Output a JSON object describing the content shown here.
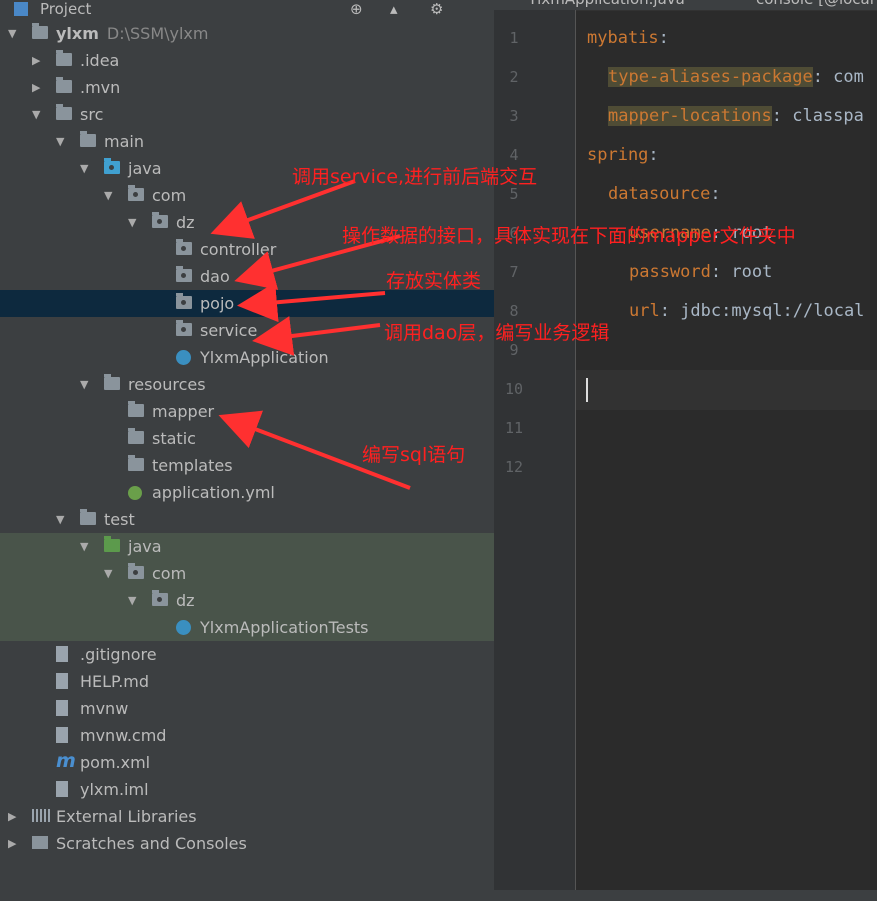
{
  "panel": {
    "title": "Project"
  },
  "tree": [
    {
      "label": "ylxm",
      "path": "D:\\SSM\\ylxm",
      "level": 0,
      "arrow": "down",
      "icon": "module"
    },
    {
      "label": ".idea",
      "level": 1,
      "arrow": "right",
      "icon": "folder"
    },
    {
      "label": ".mvn",
      "level": 1,
      "arrow": "right",
      "icon": "folder"
    },
    {
      "label": "src",
      "level": 1,
      "arrow": "down",
      "icon": "folder"
    },
    {
      "label": "main",
      "level": 2,
      "arrow": "down",
      "icon": "folder"
    },
    {
      "label": "java",
      "level": 3,
      "arrow": "down",
      "icon": "source-folder"
    },
    {
      "label": "com",
      "level": 4,
      "arrow": "down",
      "icon": "package"
    },
    {
      "label": "dz",
      "level": 5,
      "arrow": "down",
      "icon": "package"
    },
    {
      "label": "controller",
      "level": 6,
      "icon": "package"
    },
    {
      "label": "dao",
      "level": 6,
      "icon": "package"
    },
    {
      "label": "pojo",
      "level": 6,
      "icon": "package",
      "selected": true
    },
    {
      "label": "service",
      "level": 6,
      "icon": "package"
    },
    {
      "label": "YlxmApplication",
      "level": 6,
      "icon": "spring-class"
    },
    {
      "label": "resources",
      "level": 3,
      "arrow": "down",
      "icon": "resources-folder"
    },
    {
      "label": "mapper",
      "level": 4,
      "icon": "folder"
    },
    {
      "label": "static",
      "level": 4,
      "icon": "folder"
    },
    {
      "label": "templates",
      "level": 4,
      "icon": "folder"
    },
    {
      "label": "application.yml",
      "level": 4,
      "icon": "yml"
    },
    {
      "label": "test",
      "level": 2,
      "arrow": "down",
      "icon": "folder"
    },
    {
      "label": "java",
      "level": 3,
      "arrow": "down",
      "icon": "test-folder",
      "test": true
    },
    {
      "label": "com",
      "level": 4,
      "arrow": "down",
      "icon": "package",
      "test": true
    },
    {
      "label": "dz",
      "level": 5,
      "arrow": "down",
      "icon": "package",
      "test": true
    },
    {
      "label": "YlxmApplicationTests",
      "level": 6,
      "icon": "class",
      "test": true
    },
    {
      "label": ".gitignore",
      "level": 1,
      "icon": "file"
    },
    {
      "label": "HELP.md",
      "level": 1,
      "icon": "file"
    },
    {
      "label": "mvnw",
      "level": 1,
      "icon": "file"
    },
    {
      "label": "mvnw.cmd",
      "level": 1,
      "icon": "file"
    },
    {
      "label": "pom.xml",
      "level": 1,
      "icon": "maven"
    },
    {
      "label": "ylxm.iml",
      "level": 1,
      "icon": "file"
    },
    {
      "label": "External Libraries",
      "level": 0,
      "arrow": "right",
      "icon": "library"
    },
    {
      "label": "Scratches and Consoles",
      "level": 0,
      "arrow": "right",
      "icon": "scratches"
    }
  ],
  "editor": {
    "tabs": [
      "YlxmApplication.java",
      "console [@local"
    ],
    "lines": [
      {
        "n": "1",
        "indent": 0,
        "key": "mybatis",
        "rest": ":"
      },
      {
        "n": "2",
        "indent": 1,
        "key": "type-aliases-package",
        "rest": ": com",
        "hl": true
      },
      {
        "n": "3",
        "indent": 1,
        "key": "mapper-locations",
        "rest": ": classpa",
        "hl": true
      },
      {
        "n": "4",
        "indent": 0,
        "key": "spring",
        "rest": ":"
      },
      {
        "n": "5",
        "indent": 1,
        "key": "datasource",
        "rest": ":"
      },
      {
        "n": "6",
        "indent": 2,
        "key": "username",
        "rest": ": root"
      },
      {
        "n": "7",
        "indent": 2,
        "key": "password",
        "rest": ": root"
      },
      {
        "n": "8",
        "indent": 2,
        "key": "url",
        "rest": ": jdbc:mysql://local"
      },
      {
        "n": "9"
      },
      {
        "n": "10"
      },
      {
        "n": "11"
      },
      {
        "n": "12"
      }
    ]
  },
  "annotations": [
    "调用service,进行前后端交互",
    "操作数据的接口，具体实现在下面的mapper文件夹中",
    "存放实体类",
    "调用dao层，编写业务逻辑",
    "编写sql语句"
  ],
  "colors": {
    "annotation": "#ff2020",
    "selection": "#0d293e",
    "test_bg": "#49544a",
    "yaml_key": "#cc7832"
  }
}
